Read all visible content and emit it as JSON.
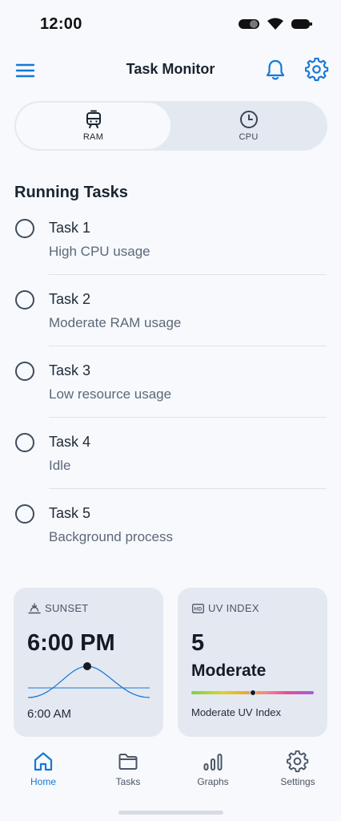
{
  "status_bar": {
    "time": "12:00"
  },
  "app_bar": {
    "title": "Task Monitor"
  },
  "segments": [
    {
      "label": "RAM",
      "icon": "train-icon",
      "selected": true
    },
    {
      "label": "CPU",
      "icon": "clock-icon",
      "selected": false
    }
  ],
  "section_title": "Running Tasks",
  "tasks": [
    {
      "title": "Task 1",
      "subtitle": "High CPU usage"
    },
    {
      "title": "Task 2",
      "subtitle": "Moderate RAM usage"
    },
    {
      "title": "Task 3",
      "subtitle": "Low resource usage"
    },
    {
      "title": "Task 4",
      "subtitle": "Idle"
    },
    {
      "title": "Task 5",
      "subtitle": "Background process"
    }
  ],
  "sunset_card": {
    "heading": "SUNSET",
    "time": "6:00 PM",
    "sunrise": "6:00 AM"
  },
  "uv_card": {
    "heading": "UV INDEX",
    "value": "5",
    "level": "Moderate",
    "description": "Moderate UV Index",
    "indicator_fraction": 0.5
  },
  "bottom_nav": [
    {
      "label": "Home",
      "icon": "home-icon",
      "active": true
    },
    {
      "label": "Tasks",
      "icon": "folder-icon",
      "active": false
    },
    {
      "label": "Graphs",
      "icon": "bar-graph-icon",
      "active": false
    },
    {
      "label": "Settings",
      "icon": "gear-icon",
      "active": false
    }
  ],
  "colors": {
    "accent": "#1778d6",
    "background": "#f7f9fc",
    "card": "#e4e9f1",
    "text": "#1a2330"
  }
}
